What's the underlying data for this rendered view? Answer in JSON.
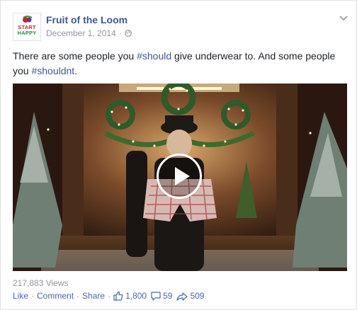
{
  "post": {
    "author": "Fruit of the Loom",
    "date": "December 1, 2014",
    "privacy_icon": "globe-icon",
    "options_icon": "chevron-down-icon",
    "text_before": "There are some people you ",
    "hashtag1": "#should",
    "text_middle": " give underwear to. And some people you ",
    "hashtag2": "#shouldnt",
    "text_end": "."
  },
  "avatar": {
    "line1": "START",
    "line2": "HAPPY"
  },
  "video": {
    "play_icon": "play-icon",
    "views": "217,883 Views"
  },
  "actions": {
    "like": "Like",
    "comment": "Comment",
    "share": "Share",
    "separator": "·",
    "likes_count": "1,800",
    "comments_count": "59",
    "shares_count": "509"
  },
  "colors": {
    "link": "#3b5998",
    "meta": "#90949c",
    "text": "#1d2129"
  }
}
